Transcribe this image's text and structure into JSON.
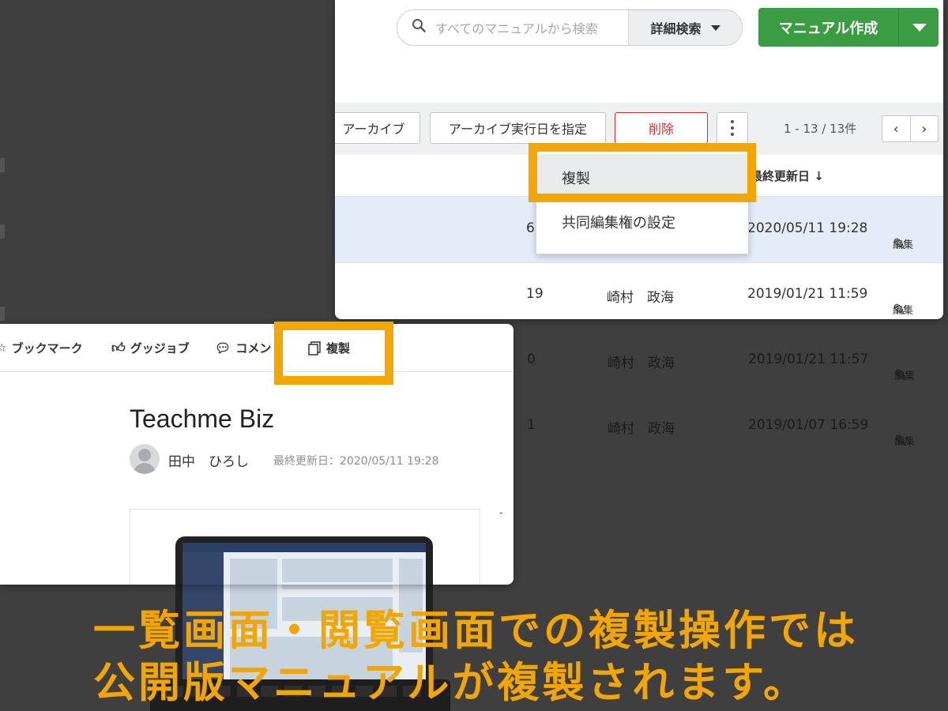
{
  "search": {
    "placeholder": "すべてのマニュアルから検索",
    "advanced_label": "詳細検索"
  },
  "create_button": {
    "label": "マニュアル作成"
  },
  "toolbar": {
    "archive_label": "アーカイブ",
    "archive_date_label": "アーカイブ実行日を指定",
    "delete_label": "削除",
    "pagination": "1 - 13 / 13件"
  },
  "table": {
    "sort_column": "最終更新日 ↓",
    "edit_label": "編集",
    "rows": [
      {
        "count": "6",
        "author": "",
        "date": "2020/05/11 19:28"
      },
      {
        "count": "19",
        "author": "崎村　政海",
        "date": "2019/01/21 11:59"
      },
      {
        "count": "0",
        "author": "崎村　政海",
        "date": "2019/01/21 11:57"
      },
      {
        "count": "1",
        "author": "崎村　政海",
        "date": "2019/01/07 16:59"
      }
    ]
  },
  "dropdown": {
    "duplicate": "複製",
    "co_edit": "共同編集権の設定"
  },
  "view": {
    "tabs": {
      "bookmark": "ブックマーク",
      "good_job": "グッジョブ",
      "comment": "コメン",
      "duplicate": "複製"
    },
    "title": "Teachme Biz",
    "author": "田中　ひろし",
    "updated": "最終更新日：2020/05/11 19:28",
    "dash": "-"
  },
  "caption": {
    "line1": "一覧画面・閲覧画面での複製操作では",
    "line2": "公開版マニュアルが複製されます。"
  },
  "colors": {
    "highlight": "#f3a600",
    "create_green": "#3a9c43",
    "delete_red": "#d0312d",
    "selected_row": "#e3ecf7"
  }
}
